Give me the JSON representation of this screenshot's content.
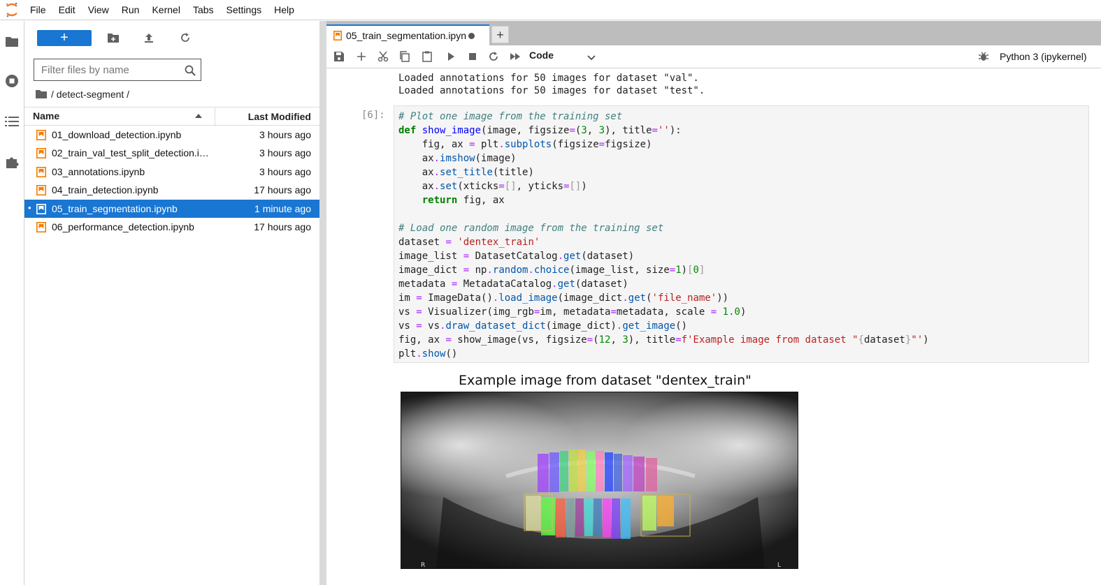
{
  "menubar": {
    "items": [
      "File",
      "Edit",
      "View",
      "Run",
      "Kernel",
      "Tabs",
      "Settings",
      "Help"
    ]
  },
  "filebrowser": {
    "new_label": "+",
    "search_placeholder": "Filter files by name",
    "breadcrumb": "/ detect-segment /",
    "columns": {
      "name": "Name",
      "modified": "Last Modified"
    },
    "files": [
      {
        "name": "01_download_detection.ipynb",
        "modified": "3 hours ago",
        "selected": false
      },
      {
        "name": "02_train_val_test_split_detection.ipynb",
        "modified": "3 hours ago",
        "selected": false
      },
      {
        "name": "03_annotations.ipynb",
        "modified": "3 hours ago",
        "selected": false
      },
      {
        "name": "04_train_detection.ipynb",
        "modified": "17 hours ago",
        "selected": false
      },
      {
        "name": "05_train_segmentation.ipynb",
        "modified": "1 minute ago",
        "selected": true
      },
      {
        "name": "06_performance_detection.ipynb",
        "modified": "17 hours ago",
        "selected": false
      }
    ]
  },
  "tabs": {
    "active_label": "05_train_segmentation.ipyn",
    "add_label": "+"
  },
  "toolbar": {
    "cell_type": "Code",
    "kernel": "Python 3 (ipykernel)"
  },
  "notebook": {
    "prev_output": [
      "Loaded annotations for 50 images for dataset \"val\".",
      "Loaded annotations for 50 images for dataset \"test\"."
    ],
    "prompt": "[6]:",
    "figure_title": "Example image from dataset \"dentex_train\""
  },
  "colors": {
    "accent": "#1976d2",
    "notebook_icon": "#f57c00"
  }
}
